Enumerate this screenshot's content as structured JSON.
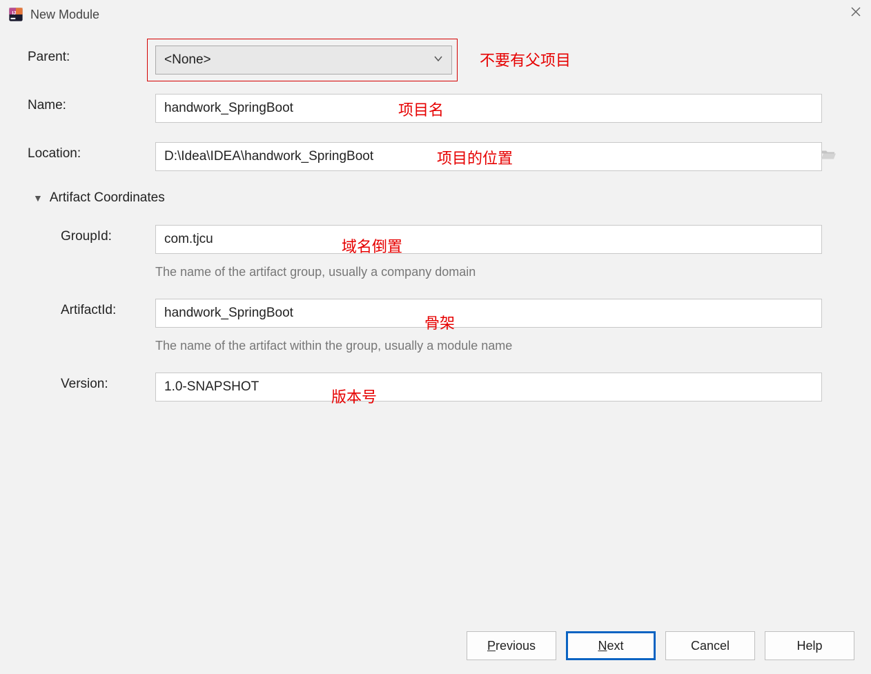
{
  "window": {
    "title": "New Module"
  },
  "fields": {
    "parent": {
      "label": "Parent:",
      "value": "<None>"
    },
    "name": {
      "label": "Name:",
      "value": "handwork_SpringBoot"
    },
    "location": {
      "label": "Location:",
      "value": "D:\\Idea\\IDEA\\handwork_SpringBoot"
    },
    "section": {
      "label": "Artifact Coordinates"
    },
    "groupId": {
      "label": "GroupId:",
      "value": "com.tjcu",
      "hint": "The name of the artifact group, usually a company domain"
    },
    "artifactId": {
      "label": "ArtifactId:",
      "value": "handwork_SpringBoot",
      "hint": "The name of the artifact within the group, usually a module name"
    },
    "version": {
      "label": "Version:",
      "value": "1.0-SNAPSHOT"
    }
  },
  "annotations": {
    "parent": "不要有父项目",
    "name": "项目名",
    "location": "项目的位置",
    "groupId": "域名倒置",
    "artifactId": "骨架",
    "version": "版本号"
  },
  "buttons": {
    "previous": "Previous",
    "next": "Next",
    "cancel": "Cancel",
    "help": "Help"
  }
}
